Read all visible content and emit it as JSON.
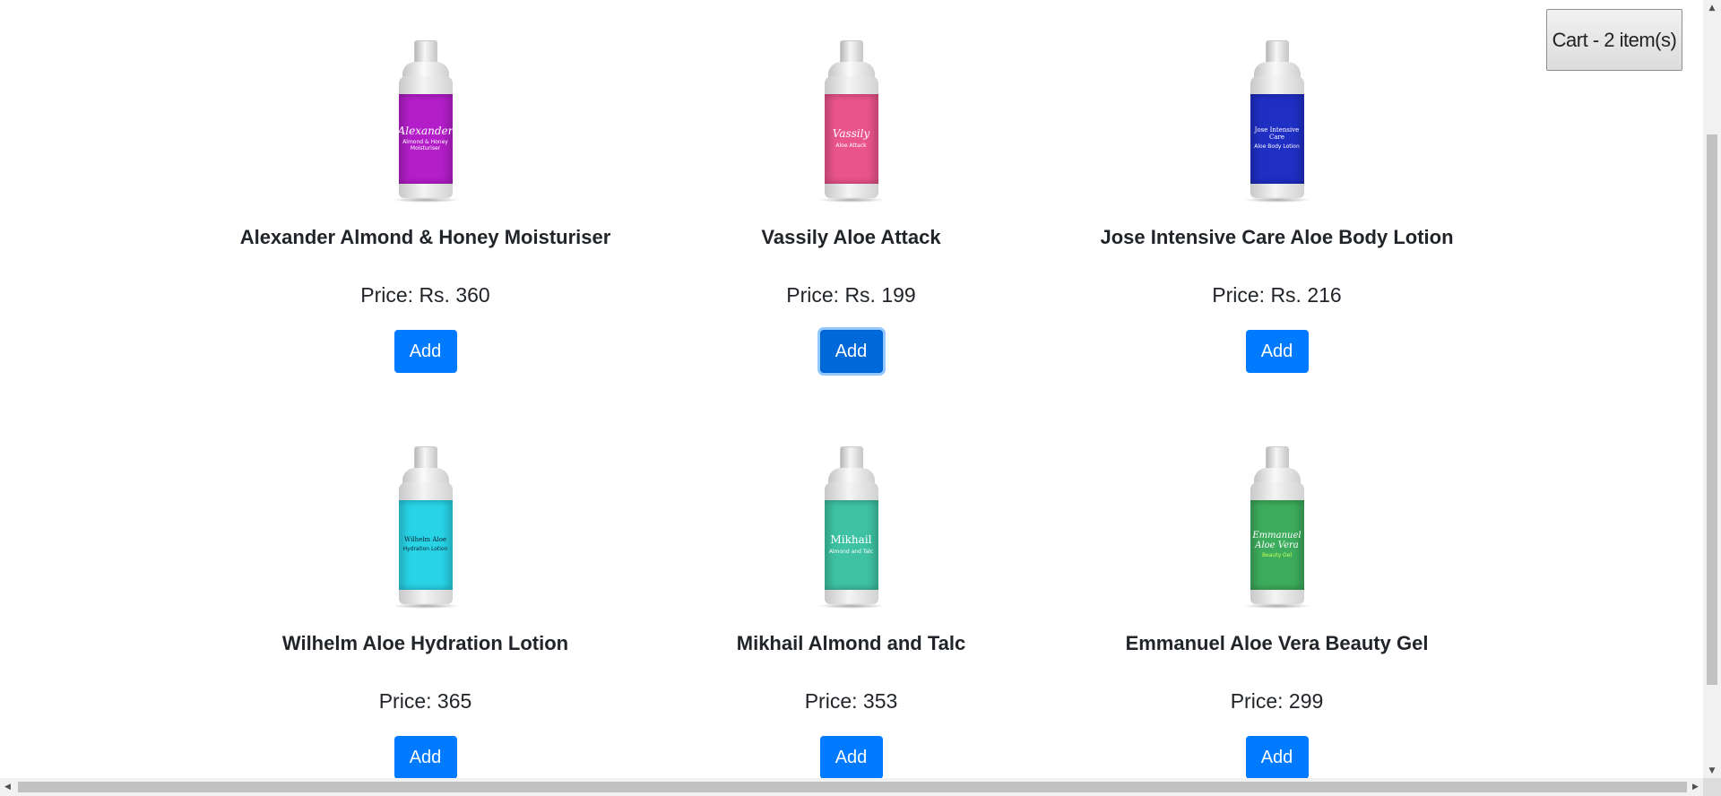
{
  "cart": {
    "label": "Cart - 2 item(s)"
  },
  "products": [
    {
      "name": "Alexander Almond & Honey Moisturiser",
      "price": "Price: Rs. 360",
      "add_label": "Add",
      "bottle_color": "#b31ec9",
      "bottle_brand": "Alexander",
      "bottle_sub": "Almond & Honey Moisturiser"
    },
    {
      "name": "Vassily Aloe Attack",
      "price": "Price: Rs. 199",
      "add_label": "Add",
      "bottle_color": "#e9548a",
      "bottle_brand": "Vassily",
      "bottle_sub": "Aloe Attack"
    },
    {
      "name": "Jose Intensive Care Aloe Body Lotion",
      "price": "Price: Rs. 216",
      "add_label": "Add",
      "bottle_color": "#1f2fc4",
      "bottle_brand": "Jose Intensive Care",
      "bottle_sub": "Aloe Body Lotion"
    },
    {
      "name": "Wilhelm Aloe Hydration Lotion",
      "price": "Price: 365",
      "add_label": "Add",
      "bottle_color": "#28d3e6",
      "bottle_brand": "Wilhelm Aloe",
      "bottle_sub": "Hydration Lotion"
    },
    {
      "name": "Mikhail Almond and Talc",
      "price": "Price: 353",
      "add_label": "Add",
      "bottle_color": "#3ec2a3",
      "bottle_brand": "Mikhail",
      "bottle_sub": "Almond and Talc"
    },
    {
      "name": "Emmanuel Aloe Vera Beauty Gel",
      "price": "Price: 299",
      "add_label": "Add",
      "bottle_color": "#3dac5c",
      "bottle_brand": "Emmanuel Aloe Vera",
      "bottle_sub": "Beauty Gel"
    }
  ],
  "focused_product": 1
}
